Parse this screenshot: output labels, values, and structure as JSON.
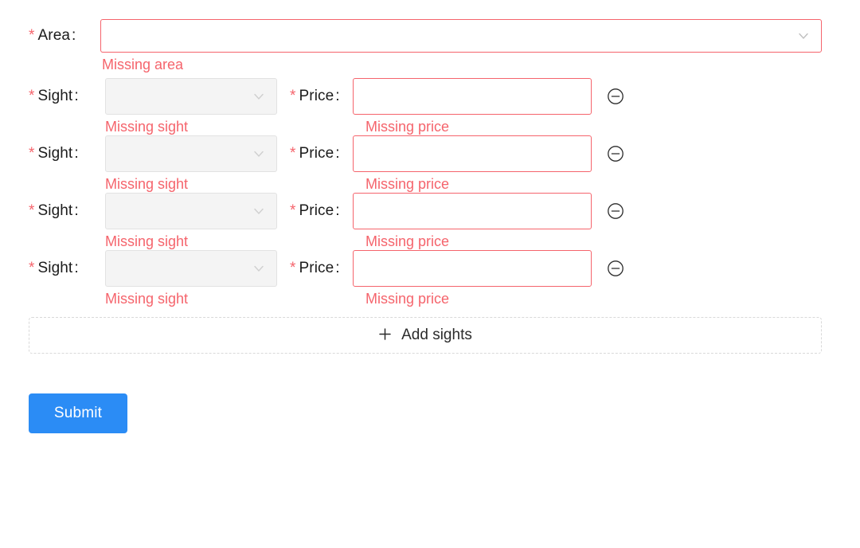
{
  "colors": {
    "error": "#f5646c",
    "primary": "#2b8cf5",
    "label": "#1b1b1b",
    "disabled_bg": "#f4f4f4",
    "dashed_border": "#d9d9d9"
  },
  "form": {
    "required_marker": "*",
    "colon": ":",
    "area": {
      "label": "Area",
      "value": "",
      "placeholder": "",
      "error": "Missing area",
      "icon": "chevron-down-icon",
      "state": "error"
    },
    "sight_rows": [
      {
        "sight_label": "Sight",
        "sight_value": "",
        "sight_placeholder": "",
        "sight_error": "Missing sight",
        "sight_icon": "chevron-down-icon",
        "sight_disabled": true,
        "price_label": "Price",
        "price_value": "",
        "price_placeholder": "",
        "price_error": "Missing price",
        "remove_icon": "minus-circle-icon"
      },
      {
        "sight_label": "Sight",
        "sight_value": "",
        "sight_placeholder": "",
        "sight_error": "Missing sight",
        "sight_icon": "chevron-down-icon",
        "sight_disabled": true,
        "price_label": "Price",
        "price_value": "",
        "price_placeholder": "",
        "price_error": "Missing price",
        "remove_icon": "minus-circle-icon"
      },
      {
        "sight_label": "Sight",
        "sight_value": "",
        "sight_placeholder": "",
        "sight_error": "Missing sight",
        "sight_icon": "chevron-down-icon",
        "sight_disabled": true,
        "price_label": "Price",
        "price_value": "",
        "price_placeholder": "",
        "price_error": "Missing price",
        "remove_icon": "minus-circle-icon"
      },
      {
        "sight_label": "Sight",
        "sight_value": "",
        "sight_placeholder": "",
        "sight_error": "Missing sight",
        "sight_icon": "chevron-down-icon",
        "sight_disabled": true,
        "price_label": "Price",
        "price_value": "",
        "price_placeholder": "",
        "price_error": "Missing price",
        "remove_icon": "minus-circle-icon"
      }
    ],
    "add_row": {
      "label": "Add sights",
      "icon": "plus-icon"
    },
    "submit": {
      "label": "Submit"
    }
  }
}
